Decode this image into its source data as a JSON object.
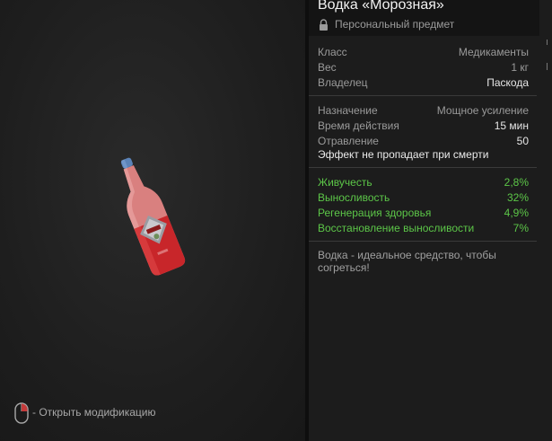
{
  "item": {
    "title": "Водка «Морозная»",
    "subtitle": "Персональный предмет"
  },
  "info": [
    {
      "label": "Класс",
      "value": "Медикаменты"
    },
    {
      "label": "Вес",
      "value": "1 кг"
    },
    {
      "label": "Владелец",
      "value": "Паскода"
    }
  ],
  "properties": [
    {
      "label": "Назначение",
      "value": "Мощное усиление"
    },
    {
      "label": "Время действия",
      "value": "15 мин"
    },
    {
      "label": "Отравление",
      "value": "50"
    }
  ],
  "effect_note": "Эффект не пропадает при смерти",
  "stats": [
    {
      "label": "Живучесть",
      "value": "2,8%"
    },
    {
      "label": "Выносливость",
      "value": "32%"
    },
    {
      "label": "Регенерация здоровья",
      "value": "4,9%"
    },
    {
      "label": "Восстановление выносливости",
      "value": "7%"
    }
  ],
  "description": "Водка - идеальное средство, чтобы согреться!",
  "hint": {
    "text": "- Открыть модификацию"
  },
  "icons": {
    "lock": "lock-icon",
    "mouse": "mouse-icon"
  },
  "colors": {
    "stat_green": "#5cc648",
    "bottle_red": "#c8262a"
  }
}
